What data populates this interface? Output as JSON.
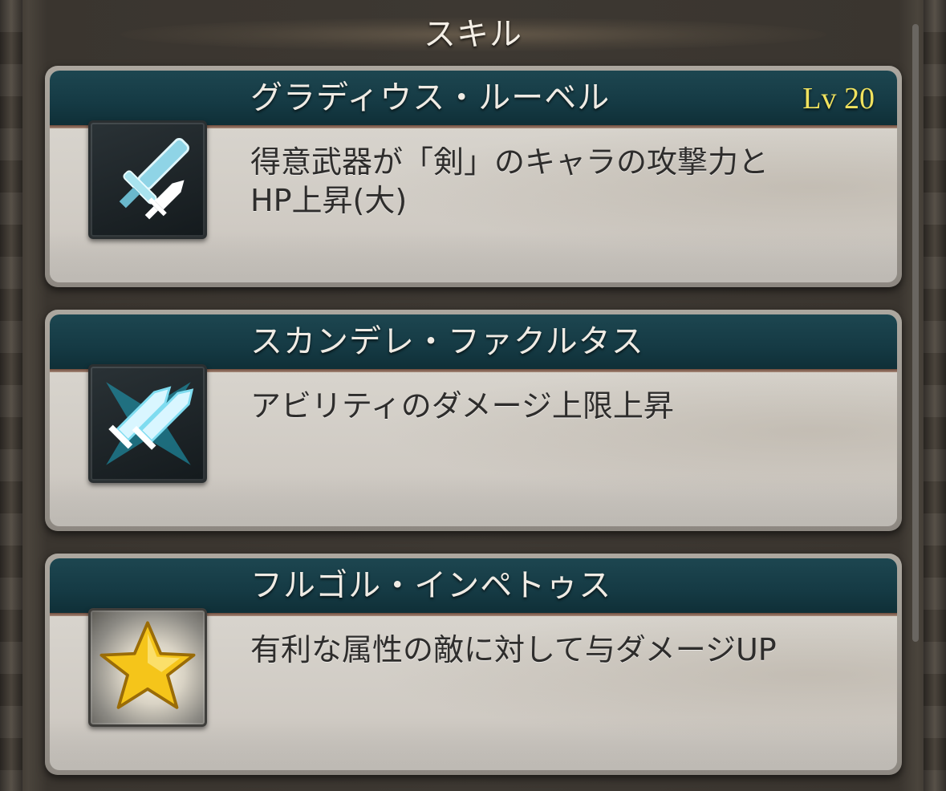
{
  "header": {
    "title": "スキル"
  },
  "skills": [
    {
      "name": "グラディウス・ルーベル",
      "level": "Lv 20",
      "description_lines": [
        "得意武器が「剣」のキャラの攻撃力と",
        "HP上昇(大)"
      ],
      "icon": "sword-icon"
    },
    {
      "name": "スカンデレ・ファクルタス",
      "level": "",
      "description_lines": [
        "アビリティのダメージ上限上昇"
      ],
      "icon": "twin-blades-icon"
    },
    {
      "name": "フルゴル・インペトゥス",
      "level": "",
      "description_lines": [
        "有利な属性の敵に対して与ダメージUP"
      ],
      "icon": "star-icon"
    }
  ],
  "colors": {
    "title_bar": "#153a44",
    "level_text": "#f0e25e",
    "card_bg": "#d5d1ca"
  }
}
